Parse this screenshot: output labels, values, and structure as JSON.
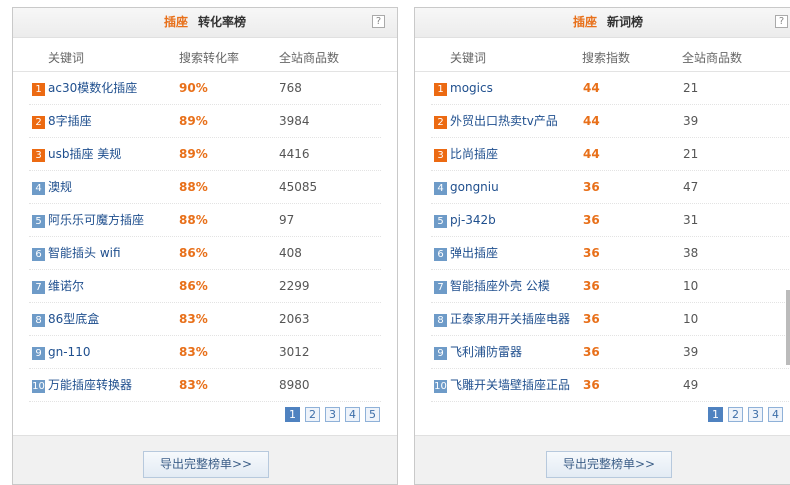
{
  "left": {
    "highlight": "插座",
    "title": "转化率榜",
    "help": "?",
    "columns": [
      "关键词",
      "搜索转化率",
      "全站商品数"
    ],
    "rows": [
      {
        "rank": "1",
        "keyword": "ac30模数化插座",
        "value": "90%",
        "count": "768"
      },
      {
        "rank": "2",
        "keyword": "8字插座",
        "value": "89%",
        "count": "3984"
      },
      {
        "rank": "3",
        "keyword": "usb插座 美规",
        "value": "89%",
        "count": "4416"
      },
      {
        "rank": "4",
        "keyword": "澳规",
        "value": "88%",
        "count": "45085"
      },
      {
        "rank": "5",
        "keyword": "阿乐乐可魔方插座",
        "value": "88%",
        "count": "97"
      },
      {
        "rank": "6",
        "keyword": "智能插头 wifi",
        "value": "86%",
        "count": "408"
      },
      {
        "rank": "7",
        "keyword": "维诺尔",
        "value": "86%",
        "count": "2299"
      },
      {
        "rank": "8",
        "keyword": "86型底盒",
        "value": "83%",
        "count": "2063"
      },
      {
        "rank": "9",
        "keyword": "gn-110",
        "value": "83%",
        "count": "3012"
      },
      {
        "rank": "10",
        "keyword": "万能插座转换器",
        "value": "83%",
        "count": "8980"
      }
    ],
    "pages": [
      "1",
      "2",
      "3",
      "4",
      "5"
    ],
    "export_label": "导出完整榜单>>"
  },
  "right": {
    "highlight": "插座",
    "title": "新词榜",
    "help": "?",
    "columns": [
      "关键词",
      "搜索指数",
      "全站商品数"
    ],
    "rows": [
      {
        "rank": "1",
        "keyword": "mogics",
        "value": "44",
        "count": "21"
      },
      {
        "rank": "2",
        "keyword": "外贸出口热卖tv产品",
        "value": "44",
        "count": "39"
      },
      {
        "rank": "3",
        "keyword": "比尚插座",
        "value": "44",
        "count": "21"
      },
      {
        "rank": "4",
        "keyword": "gongniu",
        "value": "36",
        "count": "47"
      },
      {
        "rank": "5",
        "keyword": "pj-342b",
        "value": "36",
        "count": "31"
      },
      {
        "rank": "6",
        "keyword": "弹出插座",
        "value": "36",
        "count": "38"
      },
      {
        "rank": "7",
        "keyword": "智能插座外壳 公模",
        "value": "36",
        "count": "10"
      },
      {
        "rank": "8",
        "keyword": "正泰家用开关插座电器",
        "value": "36",
        "count": "10"
      },
      {
        "rank": "9",
        "keyword": "飞利浦防雷器",
        "value": "36",
        "count": "39"
      },
      {
        "rank": "10",
        "keyword": "飞雕开关墙壁插座正品",
        "value": "36",
        "count": "49"
      }
    ],
    "pages": [
      "1",
      "2",
      "3",
      "4"
    ],
    "export_label": "导出完整榜单>>"
  }
}
